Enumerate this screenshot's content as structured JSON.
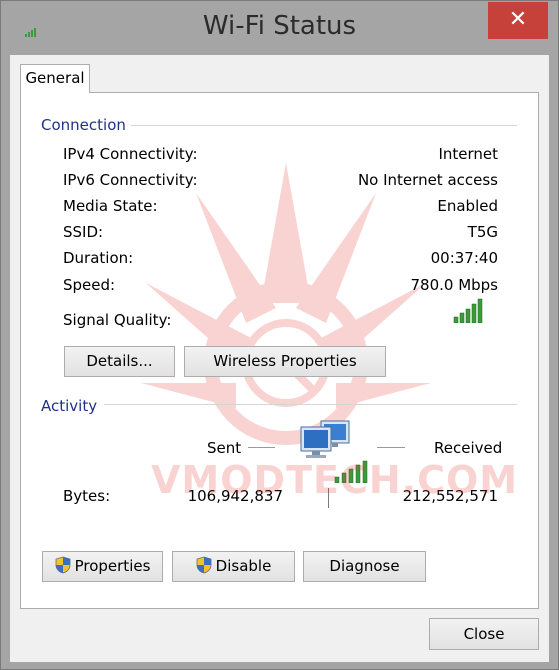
{
  "window": {
    "title": "Wi-Fi Status",
    "close_glyph": "✕"
  },
  "tabs": [
    {
      "label": "General"
    }
  ],
  "connection": {
    "title": "Connection",
    "rows": [
      {
        "label": "IPv4 Connectivity:",
        "value": "Internet"
      },
      {
        "label": "IPv6 Connectivity:",
        "value": "No Internet access"
      },
      {
        "label": "Media State:",
        "value": "Enabled"
      },
      {
        "label": "SSID:",
        "value": "T5G"
      },
      {
        "label": "Duration:",
        "value": "00:37:40"
      },
      {
        "label": "Speed:",
        "value": "780.0 Mbps"
      }
    ],
    "signal_label": "Signal Quality:",
    "signal_bars": 5,
    "details_button": "Details...",
    "wireless_properties_button": "Wireless Properties"
  },
  "activity": {
    "title": "Activity",
    "sent_label": "Sent",
    "received_label": "Received",
    "bytes_label": "Bytes:",
    "bytes_sent": "106,942,837",
    "bytes_received": "212,552,571"
  },
  "actions": {
    "properties": "Properties",
    "disable": "Disable",
    "diagnose": "Diagnose"
  },
  "footer": {
    "close": "Close"
  },
  "watermark": {
    "text": "VMODTECH.COM"
  },
  "colors": {
    "signal": "#3c9a3c",
    "accent_text": "#1e3287",
    "close_red": "#c7413b"
  }
}
